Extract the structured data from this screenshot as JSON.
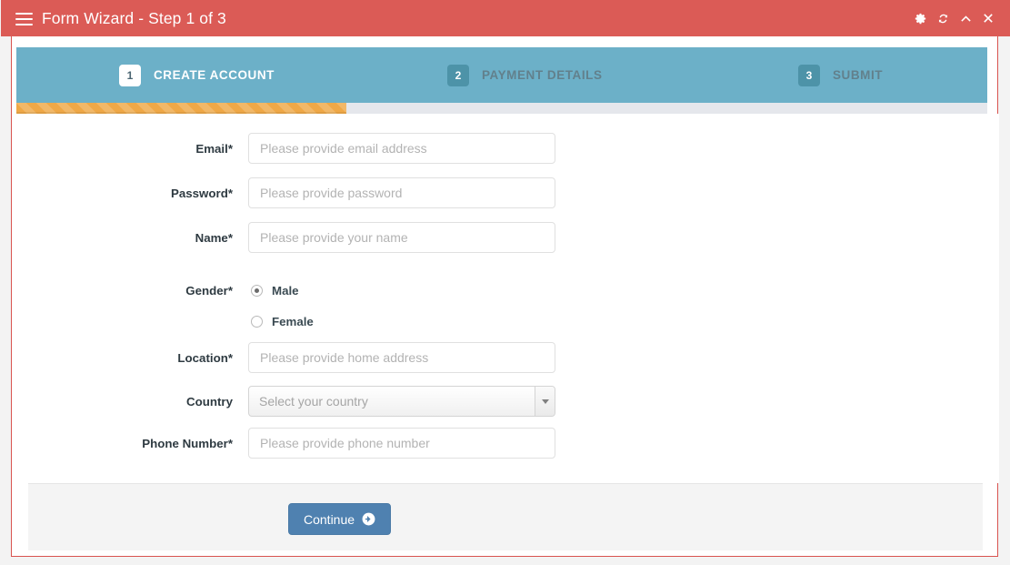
{
  "window": {
    "title": "Form Wizard - Step 1 of 3",
    "menu_icon": "hamburger-icon",
    "tools": [
      {
        "name": "gear-icon",
        "label": "Settings"
      },
      {
        "name": "refresh-icon",
        "label": "Reload"
      },
      {
        "name": "chevron-up-icon",
        "label": "Collapse"
      },
      {
        "name": "close-icon",
        "label": "Close"
      }
    ],
    "header_color": "#db5b56"
  },
  "wizard": {
    "steps": [
      {
        "number": "1",
        "label": "CREATE ACCOUNT",
        "active": true
      },
      {
        "number": "2",
        "label": "PAYMENT DETAILS",
        "active": false
      },
      {
        "number": "3",
        "label": "SUBMIT",
        "active": false
      }
    ],
    "progress_percent": 34,
    "bar_color": "#6cb0c8",
    "progress_color": "#efa847"
  },
  "form": {
    "fields": [
      {
        "label": "Email*",
        "placeholder": "Please provide email address",
        "value": "",
        "type": "text",
        "name": "email"
      },
      {
        "label": "Password*",
        "placeholder": "Please provide password",
        "value": "",
        "type": "password",
        "name": "password"
      },
      {
        "label": "Name*",
        "placeholder": "Please provide your name",
        "value": "",
        "type": "text",
        "name": "name"
      },
      {
        "label": "Location*",
        "placeholder": "Please provide home address",
        "value": "",
        "type": "text",
        "name": "location"
      },
      {
        "label": "Phone Number*",
        "placeholder": "Please provide phone number",
        "value": "",
        "type": "text",
        "name": "phone"
      }
    ],
    "gender": {
      "label": "Gender*",
      "options": [
        {
          "label": "Male",
          "checked": true
        },
        {
          "label": "Female",
          "checked": false
        }
      ]
    },
    "country": {
      "label": "Country",
      "placeholder": "Select your country",
      "selected": ""
    }
  },
  "footer": {
    "continue_label": "Continue",
    "continue_icon": "arrow-circle-right-icon",
    "button_color": "#4f81b0"
  }
}
